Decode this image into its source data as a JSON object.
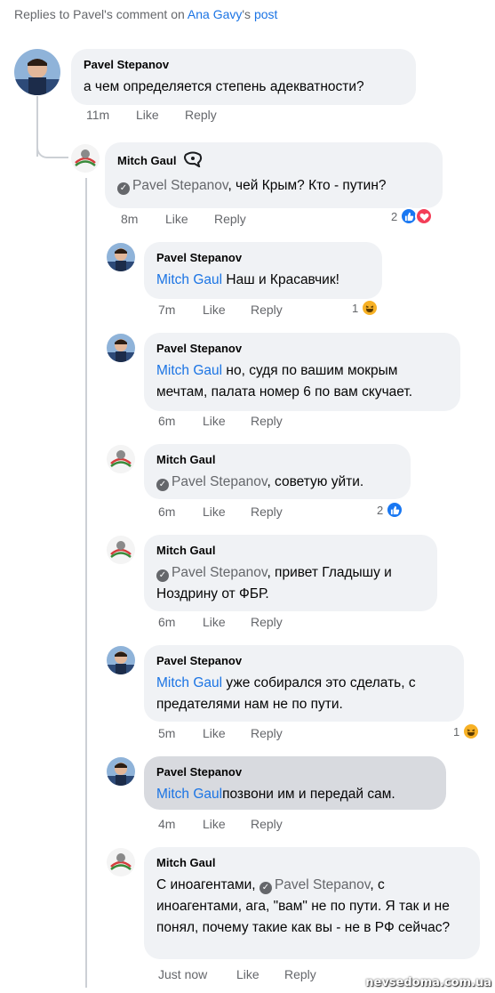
{
  "header": {
    "prefix": "Replies to Pavel's comment on ",
    "page_name": "Ana Gavy",
    "possessive": "'s",
    "post_word": "post"
  },
  "actions": {
    "like": "Like",
    "reply": "Reply"
  },
  "colors": {
    "link": "#1b74e4",
    "bubble": "#f0f2f5",
    "bubble_highlight": "#d8dadf",
    "meta": "#65676b"
  },
  "comments": [
    {
      "author": "Pavel Stepanov",
      "mention": "",
      "text": "а чем определяется степень адекватности?",
      "time": "11m",
      "reactions": ""
    },
    {
      "author": "Mitch Gaul",
      "badge_icon": "messenger-badge-icon",
      "mention": "Pavel Stepanov",
      "text": ", чей Крым? Кто - путин?",
      "time": "8m",
      "reactions": "2"
    },
    {
      "author": "Pavel Stepanov",
      "mention": "Mitch Gaul",
      "text": " Наш и Красавчик!",
      "time": "7m",
      "reactions": "1"
    },
    {
      "author": "Pavel Stepanov",
      "mention": "Mitch Gaul",
      "text": " но, судя по вашим мокрым мечтам, палата номер 6 по вам скучает.",
      "time": "6m",
      "reactions": ""
    },
    {
      "author": "Mitch Gaul",
      "mention": "Pavel Stepanov",
      "text": ", советую уйти.",
      "time": "6m",
      "reactions": "2"
    },
    {
      "author": "Mitch Gaul",
      "mention": "Pavel Stepanov",
      "text": ", привет Гладышу и Ноздрину от ФБР.",
      "time": "6m",
      "reactions": ""
    },
    {
      "author": "Pavel Stepanov",
      "mention": "Mitch Gaul",
      "text": "  уже собирался это сделать, с предателями нам не по пути.",
      "time": "5m",
      "reactions": "1"
    },
    {
      "author": "Pavel Stepanov",
      "mention": "Mitch Gaul",
      "text": "позвони им и передай сам.",
      "time": "4m",
      "reactions": ""
    },
    {
      "author": "Mitch Gaul",
      "mention_prefix": "С иноагентами, ",
      "mention": "Pavel Stepanov",
      "text": ", с иноагентами, ага, \"вам\" не по пути. Я так и не понял, почему такие как вы - не в РФ сейчас?",
      "time": "Just now",
      "reactions": ""
    }
  ],
  "watermark": "nevsedoma.com.ua"
}
